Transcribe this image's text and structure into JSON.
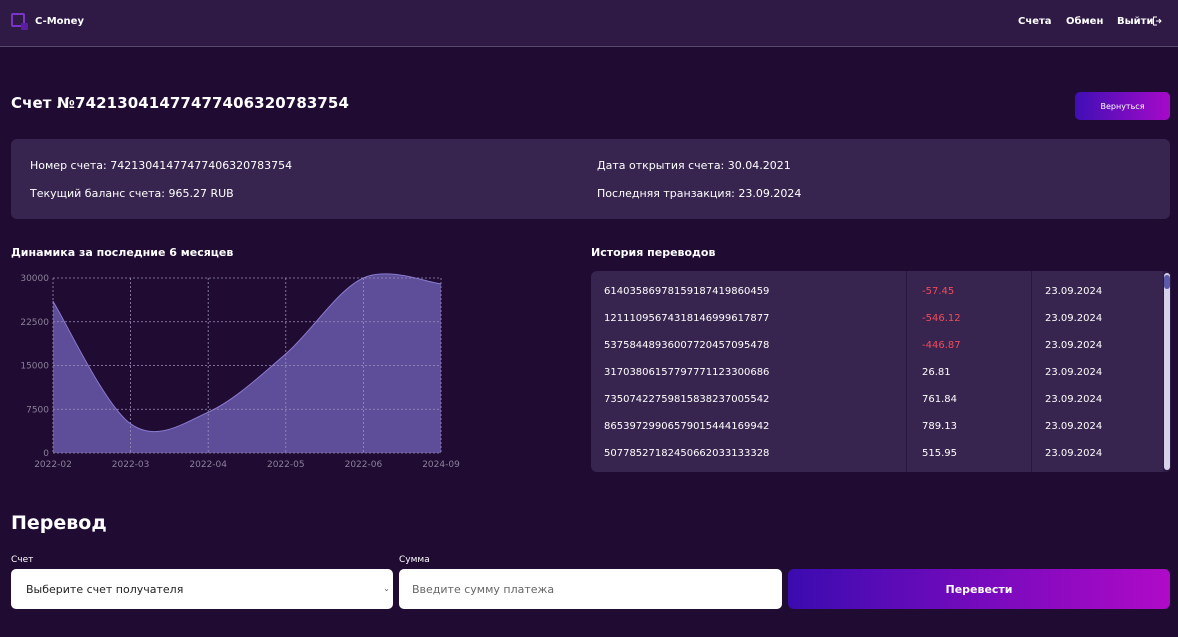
{
  "header": {
    "app_name": "C-Money",
    "nav": [
      {
        "label": "Счета"
      },
      {
        "label": "Обмен"
      },
      {
        "label": "Выйти"
      }
    ]
  },
  "account": {
    "title": "Счет №74213041477477406320783754",
    "back_label": "Вернуться",
    "number_line": "Номер счета: 74213041477477406320783754",
    "balance_line": "Текущий баланс счета: 965.27 RUB",
    "opened_line": "Дата открытия счета: 30.04.2021",
    "last_tx_line": "Последняя транзакция: 23.09.2024"
  },
  "dynamics": {
    "title": "Динамика за последние 6 месяцев"
  },
  "chart_data": {
    "type": "area",
    "categories": [
      "2022-02",
      "2022-03",
      "2022-04",
      "2022-05",
      "2022-06",
      "2024-09"
    ],
    "values": [
      26000,
      5000,
      7000,
      17000,
      30000,
      29000
    ],
    "yticks": [
      0,
      7500,
      15000,
      22500,
      30000
    ],
    "ylim": [
      0,
      30000
    ],
    "grid": true,
    "fill_color": "#5e4e9a",
    "line_color": "#8a7ad0"
  },
  "history": {
    "title": "История переводов",
    "rows": [
      {
        "account": "61403586978159187419860459",
        "amount": "-57.45",
        "date": "23.09.2024",
        "negative": true
      },
      {
        "account": "12111095674318146999617877",
        "amount": "-546.12",
        "date": "23.09.2024",
        "negative": true
      },
      {
        "account": "53758448936007720457095478",
        "amount": "-446.87",
        "date": "23.09.2024",
        "negative": true
      },
      {
        "account": "31703806157797771123300686",
        "amount": "26.81",
        "date": "23.09.2024",
        "negative": false
      },
      {
        "account": "73507422759815838237005542",
        "amount": "761.84",
        "date": "23.09.2024",
        "negative": false
      },
      {
        "account": "86539729906579015444169942",
        "amount": "789.13",
        "date": "23.09.2024",
        "negative": false
      },
      {
        "account": "50778527182450662033133328",
        "amount": "515.95",
        "date": "23.09.2024",
        "negative": false
      }
    ]
  },
  "transfer": {
    "title": "Перевод",
    "account_label": "Счет",
    "account_placeholder": "Выберите счет получателя",
    "amount_label": "Сумма",
    "amount_placeholder": "Введите сумму платежа",
    "submit_label": "Перевести"
  },
  "colors": {
    "background": "#200b33",
    "header": "#2f1a46",
    "card": "#38254f",
    "negative": "#f04a5c",
    "accent_start": "#3b0bb0",
    "accent_end": "#b00ac8"
  }
}
